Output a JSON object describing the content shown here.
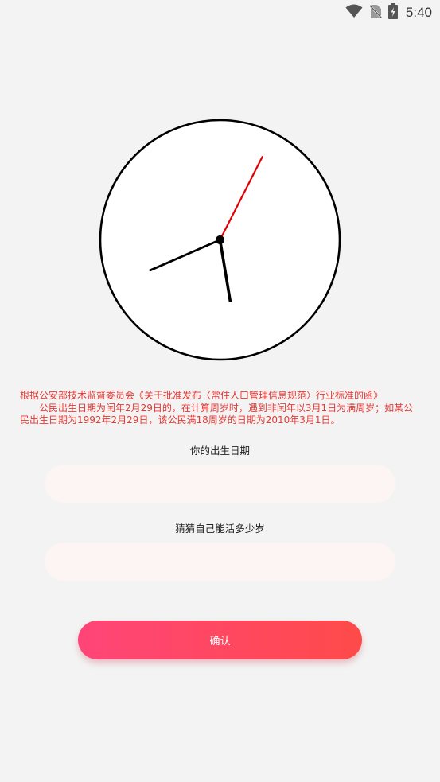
{
  "status_bar": {
    "time": "5:40",
    "icons": [
      "wifi-icon",
      "no-sim-icon",
      "battery-charging-icon"
    ]
  },
  "clock": {
    "hour": 5,
    "minute": 41,
    "second": 4.5,
    "face_color": "#ffffff",
    "rim_color": "#000000",
    "second_hand_color": "#e00000"
  },
  "notice": {
    "line1": "根据公安部技术监督委员会《关于批准发布〈常住人口管理信息规范〉行业标准的函》",
    "line2": "公民出生日期为闰年2月29日的，在计算周岁时，遇到非闰年以3月1日为满周岁；如某公民出生日期为1992年2月29日，该公民满18周岁的日期为2010年3月1日。",
    "color": "#e53935"
  },
  "form": {
    "birth_label": "你的出生日期",
    "birth_value": "",
    "guess_label": "猜猜自己能活多少岁",
    "guess_value": "",
    "confirm_label": "确认"
  },
  "colors": {
    "background": "#f3f3f3",
    "input_bg": "#fdf4f4",
    "button_gradient_start": "#ff4578",
    "button_gradient_end": "#ff4a4a"
  }
}
